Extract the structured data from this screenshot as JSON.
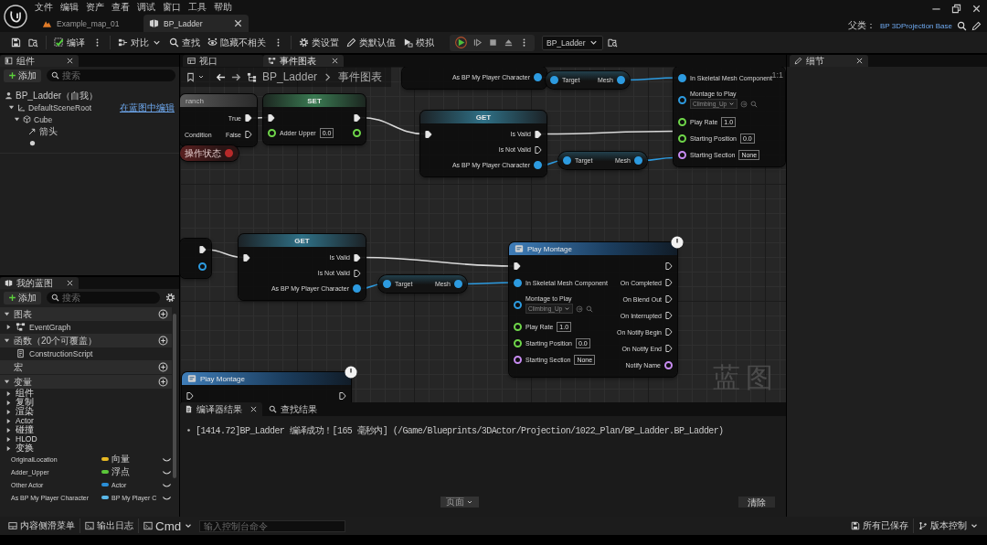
{
  "title_bar": {
    "menu": [
      "文件",
      "编辑",
      "资产",
      "查看",
      "调试",
      "窗口",
      "工具",
      "帮助"
    ],
    "tabs": [
      {
        "label": "Example_map_01",
        "kind": "level",
        "selected": false
      },
      {
        "label": "BP_Ladder",
        "kind": "blueprint",
        "selected": true
      }
    ],
    "parent_class": {
      "label": "父类：",
      "value": "BP 3DProjection Base"
    }
  },
  "toolbar": {
    "buttons": [
      {
        "label": "编译"
      },
      {
        "label": "对比"
      },
      {
        "label": "查找"
      },
      {
        "label": "隐藏不相关"
      },
      {
        "label": "类设置"
      },
      {
        "label": "类默认值"
      },
      {
        "label": "模拟"
      }
    ],
    "debug_object": "BP_Ladder"
  },
  "components_panel": {
    "tab": "组件",
    "add_button": "添加",
    "search": {
      "placeholder": "搜索"
    },
    "tree": [
      {
        "label": "BP_Ladder（自我）",
        "kind": "self",
        "children": [
          {
            "label": "DefaultSceneRoot",
            "kind": "scene",
            "expanded": true,
            "link": "在蓝图中编辑",
            "children": [
              {
                "label": "Cube",
                "kind": "mesh",
                "expanded": true,
                "children": [
                  {
                    "label": "箭头",
                    "kind": "arrow"
                  },
                  {
                    "kind": "dot"
                  }
                ]
              }
            ]
          }
        ]
      }
    ]
  },
  "my_blueprint_panel": {
    "tab": "我的蓝图",
    "add_button": "添加",
    "search": {
      "placeholder": "搜索"
    },
    "sections": [
      {
        "title": "图表",
        "expanded": true,
        "items": [
          {
            "label": "EventGraph",
            "kind": "graph",
            "expanded": false
          }
        ]
      },
      {
        "title": "函数（20个可覆盖）",
        "expanded": true,
        "items": [
          {
            "label": "ConstructionScript",
            "kind": "function"
          }
        ]
      },
      {
        "title": "宏"
      },
      {
        "title": "变量",
        "expanded": true,
        "categories": [
          {
            "label": "组件",
            "expanded": false
          },
          {
            "label": "复制",
            "expanded": false
          },
          {
            "label": "渲染",
            "expanded": false
          },
          {
            "label": "Actor",
            "expanded": false
          },
          {
            "label": "碰撞",
            "expanded": false
          },
          {
            "label": "HLOD",
            "expanded": false
          },
          {
            "label": "变换",
            "expanded": false
          }
        ],
        "variables": [
          {
            "name": "OriginalLocation",
            "type": "向量",
            "color": "#e8b923"
          },
          {
            "name": "Adder_Upper",
            "type": "浮点",
            "color": "#5cc73a"
          },
          {
            "name": "Other Actor",
            "type": "Actor",
            "color": "#2a8fd8"
          },
          {
            "name": "As BP My Player Character",
            "type": "BP My Player C",
            "color": "#5ab8e8"
          }
        ]
      }
    ]
  },
  "center_tabs": [
    {
      "label": "视口",
      "kind": "viewport",
      "selected": false
    },
    {
      "label": "事件图表",
      "kind": "graph",
      "selected": true
    }
  ],
  "graph": {
    "breadcrumb": [
      "BP_Ladder",
      "事件图表"
    ],
    "zoom_label": "1:1",
    "corner_label": "蓝图",
    "nodes": [
      {
        "kind": "branch",
        "title": "ranch",
        "inputs": [
          {
            "kind": "label",
            "label": "Condition"
          }
        ],
        "outputs": [
          {
            "kind": "exec",
            "label": "True",
            "connected": true
          },
          {
            "kind": "exec",
            "label": "False",
            "connected": false
          }
        ]
      },
      {
        "kind": "variable",
        "title": "操作状态",
        "outputs": [
          {
            "kind": "data",
            "color": "#b82a2a",
            "connected": true
          }
        ]
      },
      {
        "kind": "set",
        "title": "SET",
        "inputs": [
          {
            "kind": "exec",
            "connected": true
          },
          {
            "kind": "data",
            "label": "Adder Upper",
            "value": "0.0",
            "color": "#6fd64a",
            "connected": false
          }
        ],
        "outputs": [
          {
            "kind": "exec",
            "connected": true
          },
          {
            "kind": "data",
            "color": "#6fd64a",
            "connected": false
          }
        ]
      },
      {
        "kind": "get",
        "title": "GET",
        "inputs": [
          {
            "kind": "exec",
            "connected": true
          }
        ],
        "outputs": [
          {
            "kind": "exec",
            "label": "Is Valid",
            "connected": true
          },
          {
            "kind": "exec",
            "label": "Is Not Valid",
            "connected": false
          },
          {
            "kind": "data",
            "label": "As BP My Player Character",
            "color": "#2d9be0",
            "connected": true
          }
        ]
      },
      {
        "kind": "getter",
        "inputs": [
          {
            "kind": "data",
            "label": "Target",
            "color": "#2d9be0",
            "connected": true
          }
        ],
        "outputs": [
          {
            "kind": "data",
            "label": "Mesh",
            "color": "#2d9be0",
            "connected": true
          }
        ]
      },
      {
        "kind": "get",
        "outputs": [
          {
            "kind": "data",
            "label": "As BP My Player Character",
            "color": "#2d9be0",
            "connected": true
          }
        ]
      },
      {
        "kind": "getter",
        "inputs": [
          {
            "kind": "data",
            "label": "Target",
            "color": "#2d9be0",
            "connected": true
          }
        ],
        "outputs": [
          {
            "kind": "data",
            "label": "Mesh",
            "color": "#2d9be0",
            "connected": true
          }
        ]
      },
      {
        "kind": "call",
        "latent": false,
        "inputs": [
          {
            "kind": "data",
            "label": "In Skeletal Mesh Component",
            "color": "#2d9be0",
            "connected": true
          },
          {
            "kind": "data",
            "label": "Montage to Play",
            "select": "Climbing_Up",
            "color": "#2d9be0",
            "connected": false
          },
          {
            "kind": "data",
            "label": "Play Rate",
            "value": "1.0",
            "color": "#6fd64a",
            "connected": false
          },
          {
            "kind": "data",
            "label": "Starting Position",
            "value": "0.0",
            "color": "#6fd64a",
            "connected": false
          },
          {
            "kind": "data",
            "label": "Starting Section",
            "value": "None",
            "color": "#c88cf2",
            "connected": false
          }
        ]
      },
      {
        "kind": "call",
        "latent": false,
        "outputs": [
          {
            "kind": "exec",
            "connected": true
          },
          {
            "kind": "data",
            "color": "#2d9be0",
            "connected": false
          }
        ]
      },
      {
        "kind": "get",
        "title": "GET",
        "inputs": [
          {
            "kind": "exec",
            "connected": true
          }
        ],
        "outputs": [
          {
            "kind": "exec",
            "label": "Is Valid",
            "connected": true
          },
          {
            "kind": "exec",
            "label": "Is Not Valid",
            "connected": false
          },
          {
            "kind": "data",
            "label": "As BP My Player Character",
            "color": "#2d9be0",
            "connected": true
          }
        ]
      },
      {
        "kind": "getter",
        "inputs": [
          {
            "kind": "data",
            "label": "Target",
            "color": "#2d9be0",
            "connected": true
          }
        ],
        "outputs": [
          {
            "kind": "data",
            "label": "Mesh",
            "color": "#2d9be0",
            "connected": true
          }
        ]
      },
      {
        "kind": "call",
        "title": "Play Montage",
        "latent": true,
        "inputs": [
          {
            "kind": "exec",
            "connected": true
          },
          {
            "kind": "data",
            "label": "In Skeletal Mesh Component",
            "color": "#2d9be0",
            "connected": true
          },
          {
            "kind": "data",
            "label": "Montage to Play",
            "select": "Climbing_Up",
            "color": "#2d9be0",
            "connected": false
          },
          {
            "kind": "data",
            "label": "Play Rate",
            "value": "1.0",
            "color": "#6fd64a",
            "connected": false
          },
          {
            "kind": "data",
            "label": "Starting Position",
            "value": "0.0",
            "color": "#6fd64a",
            "connected": false
          },
          {
            "kind": "data",
            "label": "Starting Section",
            "value": "None",
            "color": "#c88cf2",
            "connected": false
          }
        ],
        "outputs": [
          {
            "kind": "exec",
            "connected": false
          },
          {
            "kind": "exec",
            "label": "On Completed",
            "connected": false
          },
          {
            "kind": "exec",
            "label": "On Blend Out",
            "connected": false
          },
          {
            "kind": "exec",
            "label": "On Interrupted",
            "connected": false
          },
          {
            "kind": "exec",
            "label": "On Notify Begin",
            "connected": false
          },
          {
            "kind": "exec",
            "label": "On Notify End",
            "connected": false
          },
          {
            "kind": "data",
            "label": "Notify Name",
            "color": "#c88cf2",
            "connected": false
          }
        ]
      },
      {
        "kind": "call",
        "title": "Play Montage",
        "latent": true,
        "inputs": [
          {
            "kind": "exec",
            "connected": false
          }
        ],
        "outputs": [
          {
            "kind": "exec",
            "connected": false
          }
        ]
      }
    ]
  },
  "bottom_panel": {
    "tabs": [
      {
        "label": "编译器结果",
        "kind": "results",
        "selected": true
      },
      {
        "label": "查找结果",
        "kind": "find",
        "selected": false
      }
    ],
    "log": [
      "[1414.72]BP_Ladder 编译成功！[165 毫秒内] (/Game/Blueprints/3DActor/Projection/1022_Plan/BP_Ladder.BP_Ladder)"
    ],
    "page_button": "页面",
    "clear_button": "清除"
  },
  "details_panel": {
    "tab": "细节"
  },
  "status_bar": {
    "content_drawer": "内容侧滑菜单",
    "output_log": "输出日志",
    "cmd": "Cmd",
    "console": {
      "placeholder": "输入控制台命令"
    },
    "save_status": "所有已保存",
    "source_control": "版本控制"
  }
}
